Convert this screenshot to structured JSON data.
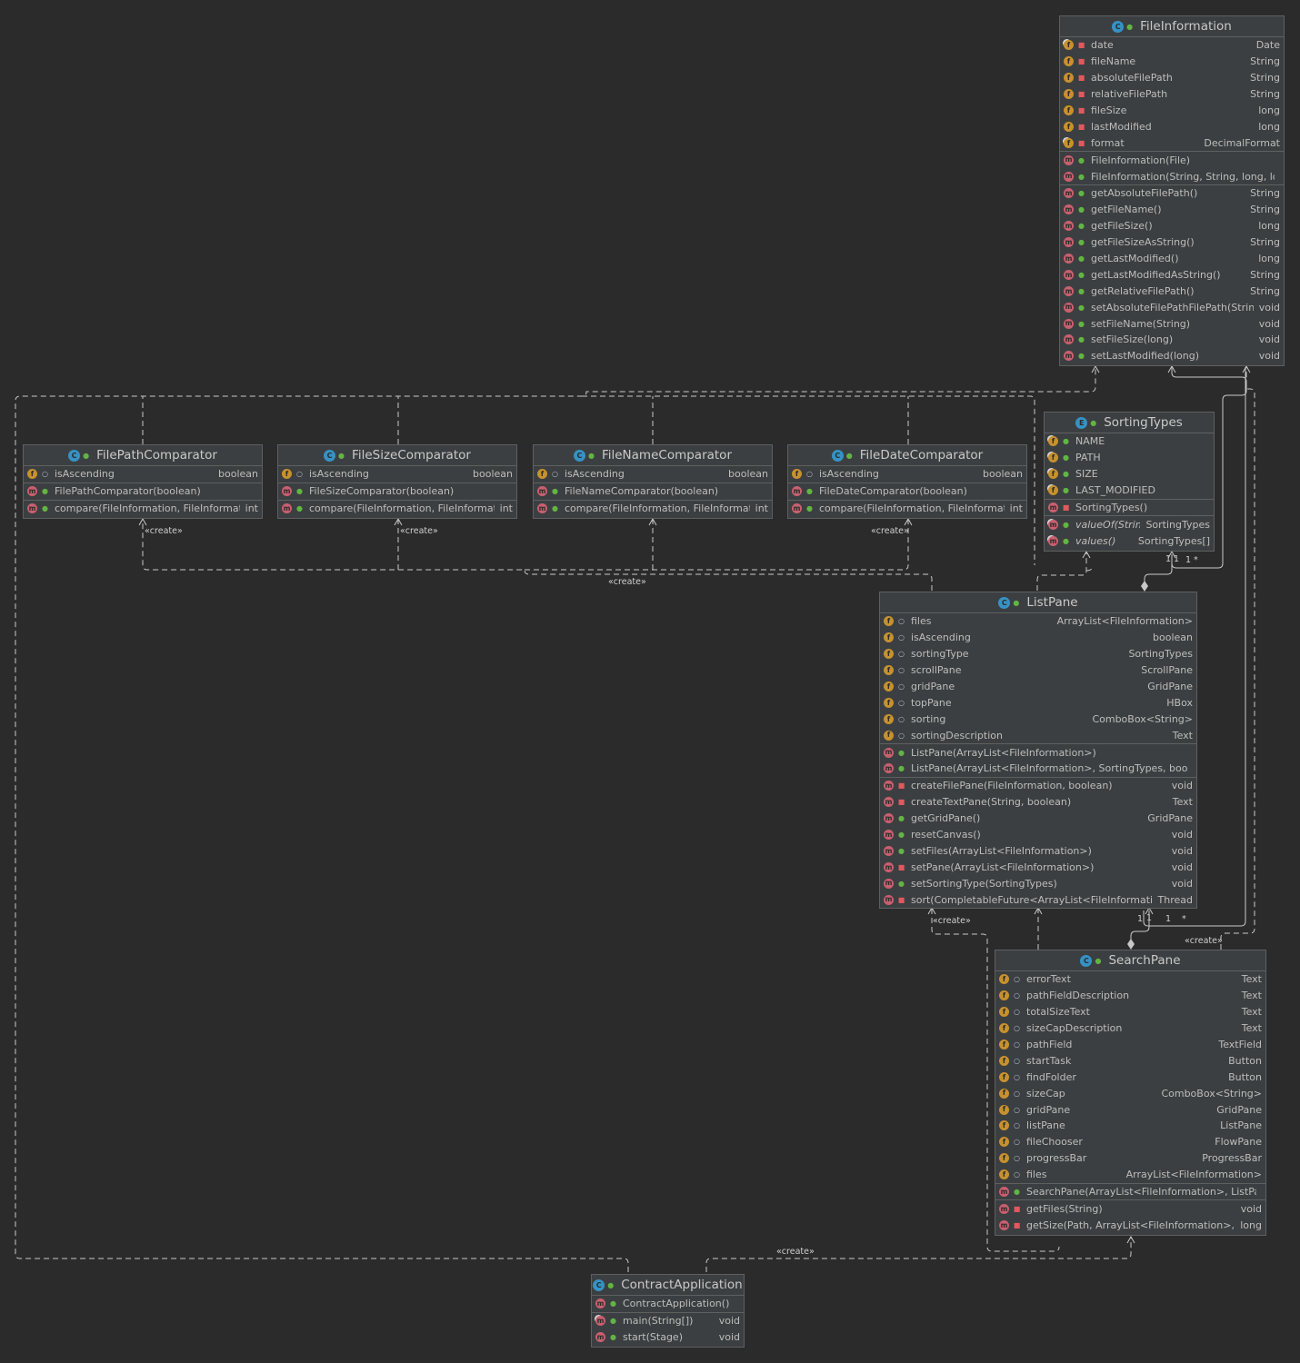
{
  "diagram": {
    "classes": {
      "fileinformation": {
        "title": "FileInformation",
        "sections": [
          [
            {
              "kind": "f",
              "vis": "priv",
              "static": true,
              "name": "date",
              "type": "Date"
            },
            {
              "kind": "f",
              "vis": "priv",
              "name": "fileName",
              "type": "String"
            },
            {
              "kind": "f",
              "vis": "priv",
              "name": "absoluteFilePath",
              "type": "String"
            },
            {
              "kind": "f",
              "vis": "priv",
              "name": "relativeFilePath",
              "type": "String"
            },
            {
              "kind": "f",
              "vis": "priv",
              "name": "fileSize",
              "type": "long"
            },
            {
              "kind": "f",
              "vis": "priv",
              "name": "lastModified",
              "type": "long"
            },
            {
              "kind": "f",
              "vis": "priv",
              "static": true,
              "name": "format",
              "type": "DecimalFormat"
            }
          ],
          [
            {
              "kind": "m",
              "vis": "pub",
              "name": "FileInformation(File)",
              "type": ""
            },
            {
              "kind": "m",
              "vis": "pub",
              "name": "FileInformation(String, String, long, long)",
              "type": ""
            }
          ],
          [
            {
              "kind": "m",
              "vis": "pub",
              "name": "getAbsoluteFilePath()",
              "type": "String"
            },
            {
              "kind": "m",
              "vis": "pub",
              "name": "getFileName()",
              "type": "String"
            },
            {
              "kind": "m",
              "vis": "pub",
              "name": "getFileSize()",
              "type": "long"
            },
            {
              "kind": "m",
              "vis": "pub",
              "name": "getFileSizeAsString()",
              "type": "String"
            },
            {
              "kind": "m",
              "vis": "pub",
              "name": "getLastModified()",
              "type": "long"
            },
            {
              "kind": "m",
              "vis": "pub",
              "name": "getLastModifiedAsString()",
              "type": "String"
            },
            {
              "kind": "m",
              "vis": "pub",
              "name": "getRelativeFilePath()",
              "type": "String"
            },
            {
              "kind": "m",
              "vis": "pub",
              "name": "setAbsoluteFilePathFilePath(String)",
              "type": "void"
            },
            {
              "kind": "m",
              "vis": "pub",
              "name": "setFileName(String)",
              "type": "void"
            },
            {
              "kind": "m",
              "vis": "pub",
              "name": "setFileSize(long)",
              "type": "void"
            },
            {
              "kind": "m",
              "vis": "pub",
              "name": "setLastModified(long)",
              "type": "void"
            }
          ]
        ]
      },
      "sortingtypes": {
        "title": "SortingTypes",
        "icon": "E",
        "sections": [
          [
            {
              "kind": "f",
              "vis": "pub",
              "static": true,
              "name": "NAME",
              "type": ""
            },
            {
              "kind": "f",
              "vis": "pub",
              "static": true,
              "name": "PATH",
              "type": ""
            },
            {
              "kind": "f",
              "vis": "pub",
              "static": true,
              "name": "SIZE",
              "type": ""
            },
            {
              "kind": "f",
              "vis": "pub",
              "static": true,
              "name": "LAST_MODIFIED",
              "type": ""
            }
          ],
          [
            {
              "kind": "m",
              "vis": "priv",
              "name": "SortingTypes()",
              "type": ""
            }
          ],
          [
            {
              "kind": "m",
              "vis": "pub",
              "static": true,
              "italic": true,
              "name": "valueOf(String)",
              "type": "SortingTypes"
            },
            {
              "kind": "m",
              "vis": "pub",
              "static": true,
              "italic": true,
              "name": "values()",
              "type": "SortingTypes[]"
            }
          ]
        ]
      },
      "filepathcomparator": {
        "title": "FilePathComparator",
        "sections": [
          [
            {
              "kind": "f",
              "vis": "pkg",
              "name": "isAscending",
              "type": "boolean"
            }
          ],
          [
            {
              "kind": "m",
              "vis": "pub",
              "name": "FilePathComparator(boolean)",
              "type": ""
            }
          ],
          [
            {
              "kind": "m",
              "vis": "pub",
              "name": "compare(FileInformation, FileInformation)",
              "type": "int"
            }
          ]
        ]
      },
      "filesizecomparator": {
        "title": "FileSizeComparator",
        "sections": [
          [
            {
              "kind": "f",
              "vis": "pkg",
              "name": "isAscending",
              "type": "boolean"
            }
          ],
          [
            {
              "kind": "m",
              "vis": "pub",
              "name": "FileSizeComparator(boolean)",
              "type": ""
            }
          ],
          [
            {
              "kind": "m",
              "vis": "pub",
              "name": "compare(FileInformation, FileInformation)",
              "type": "int"
            }
          ]
        ]
      },
      "filenamecomparator": {
        "title": "FileNameComparator",
        "sections": [
          [
            {
              "kind": "f",
              "vis": "pkg",
              "name": "isAscending",
              "type": "boolean"
            }
          ],
          [
            {
              "kind": "m",
              "vis": "pub",
              "name": "FileNameComparator(boolean)",
              "type": ""
            }
          ],
          [
            {
              "kind": "m",
              "vis": "pub",
              "name": "compare(FileInformation, FileInformation)",
              "type": "int"
            }
          ]
        ]
      },
      "filedatecomparator": {
        "title": "FileDateComparator",
        "sections": [
          [
            {
              "kind": "f",
              "vis": "pkg",
              "name": "isAscending",
              "type": "boolean"
            }
          ],
          [
            {
              "kind": "m",
              "vis": "pub",
              "name": "FileDateComparator(boolean)",
              "type": ""
            }
          ],
          [
            {
              "kind": "m",
              "vis": "pub",
              "name": "compare(FileInformation, FileInformation)",
              "type": "int"
            }
          ]
        ]
      },
      "listpane": {
        "title": "ListPane",
        "sections": [
          [
            {
              "kind": "f",
              "vis": "pkg",
              "name": "files",
              "type": "ArrayList<FileInformation>"
            },
            {
              "kind": "f",
              "vis": "pkg",
              "name": "isAscending",
              "type": "boolean"
            },
            {
              "kind": "f",
              "vis": "pkg",
              "name": "sortingType",
              "type": "SortingTypes"
            },
            {
              "kind": "f",
              "vis": "pkg",
              "name": "scrollPane",
              "type": "ScrollPane"
            },
            {
              "kind": "f",
              "vis": "pkg",
              "name": "gridPane",
              "type": "GridPane"
            },
            {
              "kind": "f",
              "vis": "pkg",
              "name": "topPane",
              "type": "HBox"
            },
            {
              "kind": "f",
              "vis": "pkg",
              "name": "sorting",
              "type": "ComboBox<String>"
            },
            {
              "kind": "f",
              "vis": "pkg",
              "name": "sortingDescription",
              "type": "Text"
            }
          ],
          [
            {
              "kind": "m",
              "vis": "pub",
              "name": "ListPane(ArrayList<FileInformation>)",
              "type": ""
            },
            {
              "kind": "m",
              "vis": "pub",
              "name": "ListPane(ArrayList<FileInformation>, SortingTypes, boolean)",
              "type": ""
            }
          ],
          [
            {
              "kind": "m",
              "vis": "priv",
              "name": "createFilePane(FileInformation, boolean)",
              "type": "void"
            },
            {
              "kind": "m",
              "vis": "priv",
              "name": "createTextPane(String, boolean)",
              "type": "Text"
            },
            {
              "kind": "m",
              "vis": "pub",
              "name": "getGridPane()",
              "type": "GridPane"
            },
            {
              "kind": "m",
              "vis": "pub",
              "name": "resetCanvas()",
              "type": "void"
            },
            {
              "kind": "m",
              "vis": "pub",
              "name": "setFiles(ArrayList<FileInformation>)",
              "type": "void"
            },
            {
              "kind": "m",
              "vis": "priv",
              "name": "setPane(ArrayList<FileInformation>)",
              "type": "void"
            },
            {
              "kind": "m",
              "vis": "pub",
              "name": "setSortingType(SortingTypes)",
              "type": "void"
            },
            {
              "kind": "m",
              "vis": "priv",
              "name": "sort(CompletableFuture<ArrayList<FileInformation>>)",
              "type": "Thread"
            }
          ]
        ]
      },
      "searchpane": {
        "title": "SearchPane",
        "sections": [
          [
            {
              "kind": "f",
              "vis": "pkg",
              "name": "errorText",
              "type": "Text"
            },
            {
              "kind": "f",
              "vis": "pkg",
              "name": "pathFieldDescription",
              "type": "Text"
            },
            {
              "kind": "f",
              "vis": "pkg",
              "name": "totalSizeText",
              "type": "Text"
            },
            {
              "kind": "f",
              "vis": "pkg",
              "name": "sizeCapDescription",
              "type": "Text"
            },
            {
              "kind": "f",
              "vis": "pkg",
              "name": "pathField",
              "type": "TextField"
            },
            {
              "kind": "f",
              "vis": "pkg",
              "name": "startTask",
              "type": "Button"
            },
            {
              "kind": "f",
              "vis": "pkg",
              "name": "findFolder",
              "type": "Button"
            },
            {
              "kind": "f",
              "vis": "pkg",
              "name": "sizeCap",
              "type": "ComboBox<String>"
            },
            {
              "kind": "f",
              "vis": "pkg",
              "name": "gridPane",
              "type": "GridPane"
            },
            {
              "kind": "f",
              "vis": "pkg",
              "name": "listPane",
              "type": "ListPane"
            },
            {
              "kind": "f",
              "vis": "pkg",
              "name": "fileChooser",
              "type": "FlowPane"
            },
            {
              "kind": "f",
              "vis": "pkg",
              "name": "progressBar",
              "type": "ProgressBar"
            },
            {
              "kind": "f",
              "vis": "pkg",
              "name": "files",
              "type": "ArrayList<FileInformation>"
            }
          ],
          [
            {
              "kind": "m",
              "vis": "pub",
              "name": "SearchPane(ArrayList<FileInformation>, ListPane)",
              "type": ""
            }
          ],
          [
            {
              "kind": "m",
              "vis": "priv",
              "name": "getFiles(String)",
              "type": "void"
            },
            {
              "kind": "m",
              "vis": "priv",
              "name": "getSize(Path, ArrayList<FileInformation>, long)",
              "type": "long"
            }
          ]
        ]
      },
      "contractapplication": {
        "title": "ContractApplication",
        "sections": [
          [
            {
              "kind": "m",
              "vis": "pub",
              "name": "ContractApplication()",
              "type": ""
            }
          ],
          [
            {
              "kind": "m",
              "vis": "pub",
              "static": true,
              "name": "main(String[])",
              "type": "void"
            },
            {
              "kind": "m",
              "vis": "pub",
              "name": "start(Stage)",
              "type": "void"
            }
          ]
        ]
      }
    },
    "edge_labels": {
      "create_filepath": "«create»",
      "create_filesize": "«create»",
      "create_filedate": "«create»",
      "create_listpane_to_comparators": "«create»",
      "create_searchpane_to_listpane": "«create»",
      "create_searchpane_to_fileinfo": "«create»",
      "create_app_to_searchpane": "«create»",
      "mult_st_1a": "1",
      "mult_st_1b": "1",
      "mult_st_1c": "1",
      "mult_st_star": "*",
      "mult_lp_1a": "1",
      "mult_lp_1b": "1",
      "mult_lp_1c": "1",
      "mult_lp_star": "*"
    }
  }
}
